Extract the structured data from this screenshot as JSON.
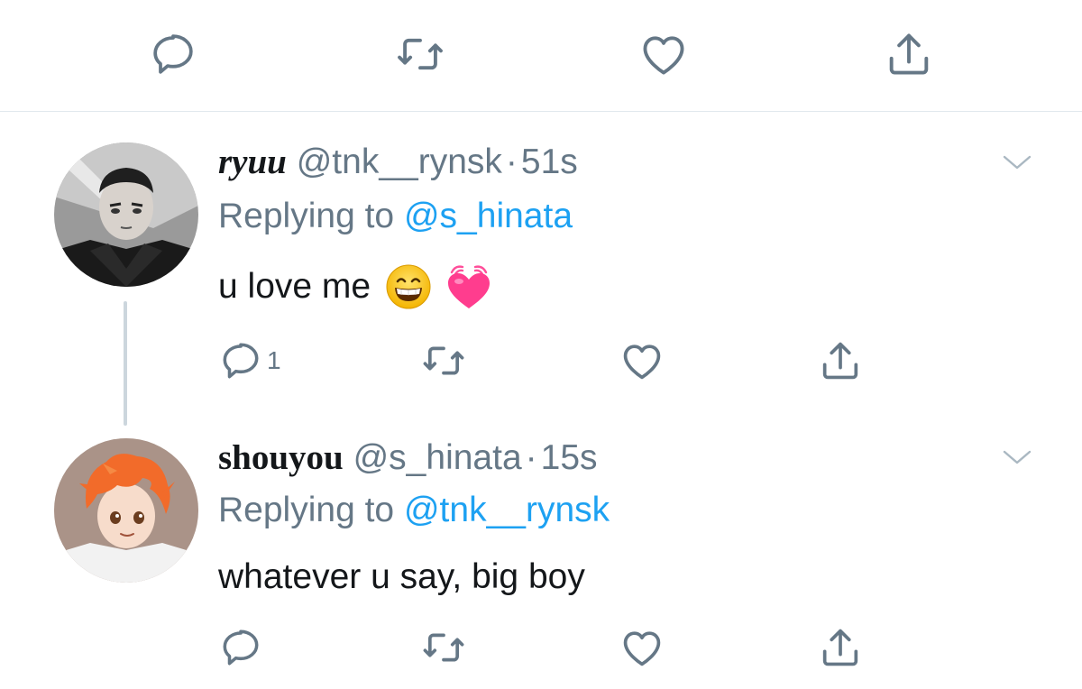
{
  "top_actions": {
    "reply_icon": "reply-icon",
    "retweet_icon": "retweet-icon",
    "like_icon": "heart-icon",
    "share_icon": "share-icon"
  },
  "colors": {
    "text_primary": "#14171a",
    "text_secondary": "#657786",
    "link_blue": "#1da1f2",
    "divider": "#e1e8ed",
    "thread_line": "#ccd6dd"
  },
  "tweets": [
    {
      "name": "ryuu",
      "handle": "@tnk__rynsk",
      "separator": "·",
      "time": "51s",
      "replying_prefix": "Replying to",
      "replying_to": "@s_hinata",
      "text": "u love me",
      "emojis": [
        "grinning-face-emoji",
        "beating-heart-emoji"
      ],
      "reply_count": "1"
    },
    {
      "name": "shouyou",
      "handle": "@s_hinata",
      "separator": "·",
      "time": "15s",
      "replying_prefix": "Replying to",
      "replying_to": "@tnk__rynsk",
      "text": "whatever u say, big boy",
      "emojis": [],
      "reply_count": ""
    }
  ]
}
